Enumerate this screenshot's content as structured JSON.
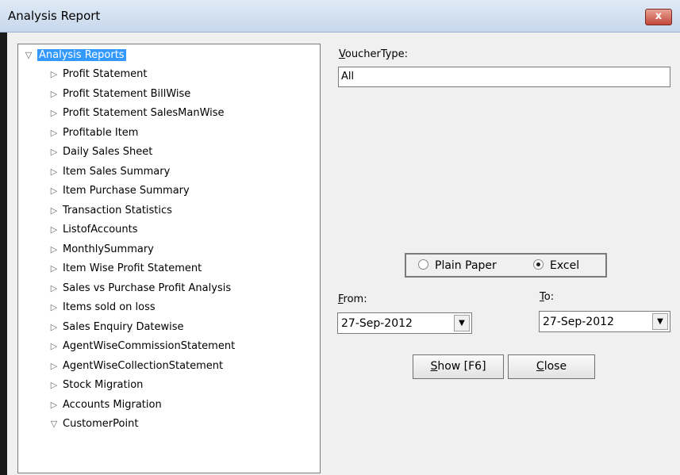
{
  "window": {
    "title": "Analysis Report",
    "close_label": "x"
  },
  "tree": {
    "root": "Analysis Reports",
    "items": [
      "Profit Statement",
      "Profit Statement BillWise",
      "Profit Statement SalesManWise",
      "Profitable Item",
      "Daily Sales Sheet",
      "Item Sales Summary",
      "Item Purchase Summary",
      "Transaction Statistics",
      "ListofAccounts",
      "MonthlySummary",
      "Item Wise Profit Statement",
      "Sales vs Purchase Profit Analysis",
      "Items sold on loss",
      "Sales Enquiry Datewise",
      "AgentWiseCommissionStatement",
      "AgentWiseCollectionStatement",
      "Stock Migration",
      "Accounts Migration",
      "CustomerPoint"
    ]
  },
  "vouchertype": {
    "label_u": "V",
    "label_rest": "oucherType:",
    "value": "All"
  },
  "output": {
    "plain_paper": "Plain Paper",
    "excel": "Excel",
    "selected": "Excel"
  },
  "from": {
    "label_u": "F",
    "label_rest": "rom:",
    "value": "27-Sep-2012"
  },
  "to": {
    "label_u": "T",
    "label_rest": "o:",
    "value": "27-Sep-2012"
  },
  "buttons": {
    "show_u": "S",
    "show_rest": "how [F6]",
    "close_u": "C",
    "close_rest": "lose"
  }
}
